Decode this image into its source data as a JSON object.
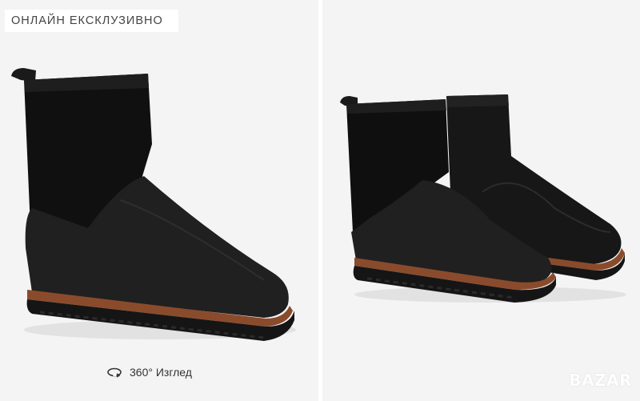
{
  "gallery": {
    "badge_text": "ОНЛАЙН ЕКСКЛУЗИВНО",
    "view360_label": "360° Изглед",
    "rotate_icon": "rotate-360-icon",
    "watermark_text": "BAZAR"
  },
  "colors": {
    "panel_bg": "#f4f4f4",
    "boot_leather": "#1c1c1c",
    "boot_suede": "#0f0f0f",
    "welt": "#8a4b2c",
    "sole": "#151515"
  }
}
